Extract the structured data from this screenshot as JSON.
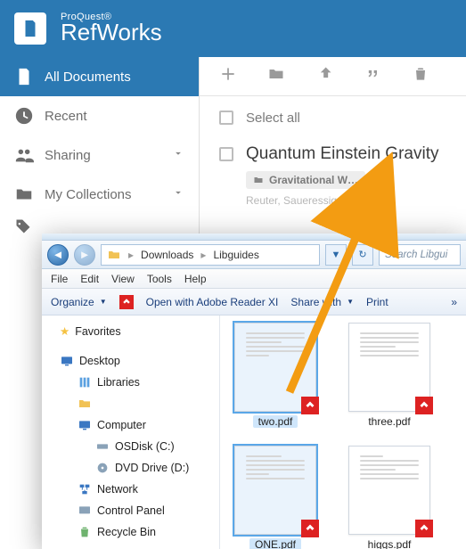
{
  "rw": {
    "brand_line1": "ProQuest®",
    "brand_line2": "RefWorks",
    "sidebar": {
      "items": [
        {
          "label": "All Documents"
        },
        {
          "label": "Recent"
        },
        {
          "label": "Sharing"
        },
        {
          "label": "My Collections"
        }
      ]
    },
    "selectall_label": "Select all",
    "doc": {
      "title": "Quantum Einstein Gravity",
      "folder": "Gravitational W…",
      "meta": "Reuter, Saueressig, 201…"
    }
  },
  "explorer": {
    "breadcrumb": {
      "a": "Downloads",
      "b": "Libguides"
    },
    "search_placeholder": "Search Libgui",
    "menu": {
      "file": "File",
      "edit": "Edit",
      "view": "View",
      "tools": "Tools",
      "help": "Help"
    },
    "cmd": {
      "organize": "Organize",
      "openwith": "Open with Adobe Reader XI",
      "sharewith": "Share with",
      "print": "Print",
      "more": "»"
    },
    "tree": {
      "favorites": "Favorites",
      "desktop": "Desktop",
      "libraries": "Libraries",
      "computer": "Computer",
      "osdisk": "OSDisk (C:)",
      "dvd": "DVD Drive (D:)",
      "network": "Network",
      "controlpanel": "Control Panel",
      "recyclebin": "Recycle Bin"
    },
    "files": [
      {
        "name": "two.pdf"
      },
      {
        "name": "three.pdf"
      },
      {
        "name": "ONE.pdf"
      },
      {
        "name": "higgs.pdf"
      }
    ]
  }
}
